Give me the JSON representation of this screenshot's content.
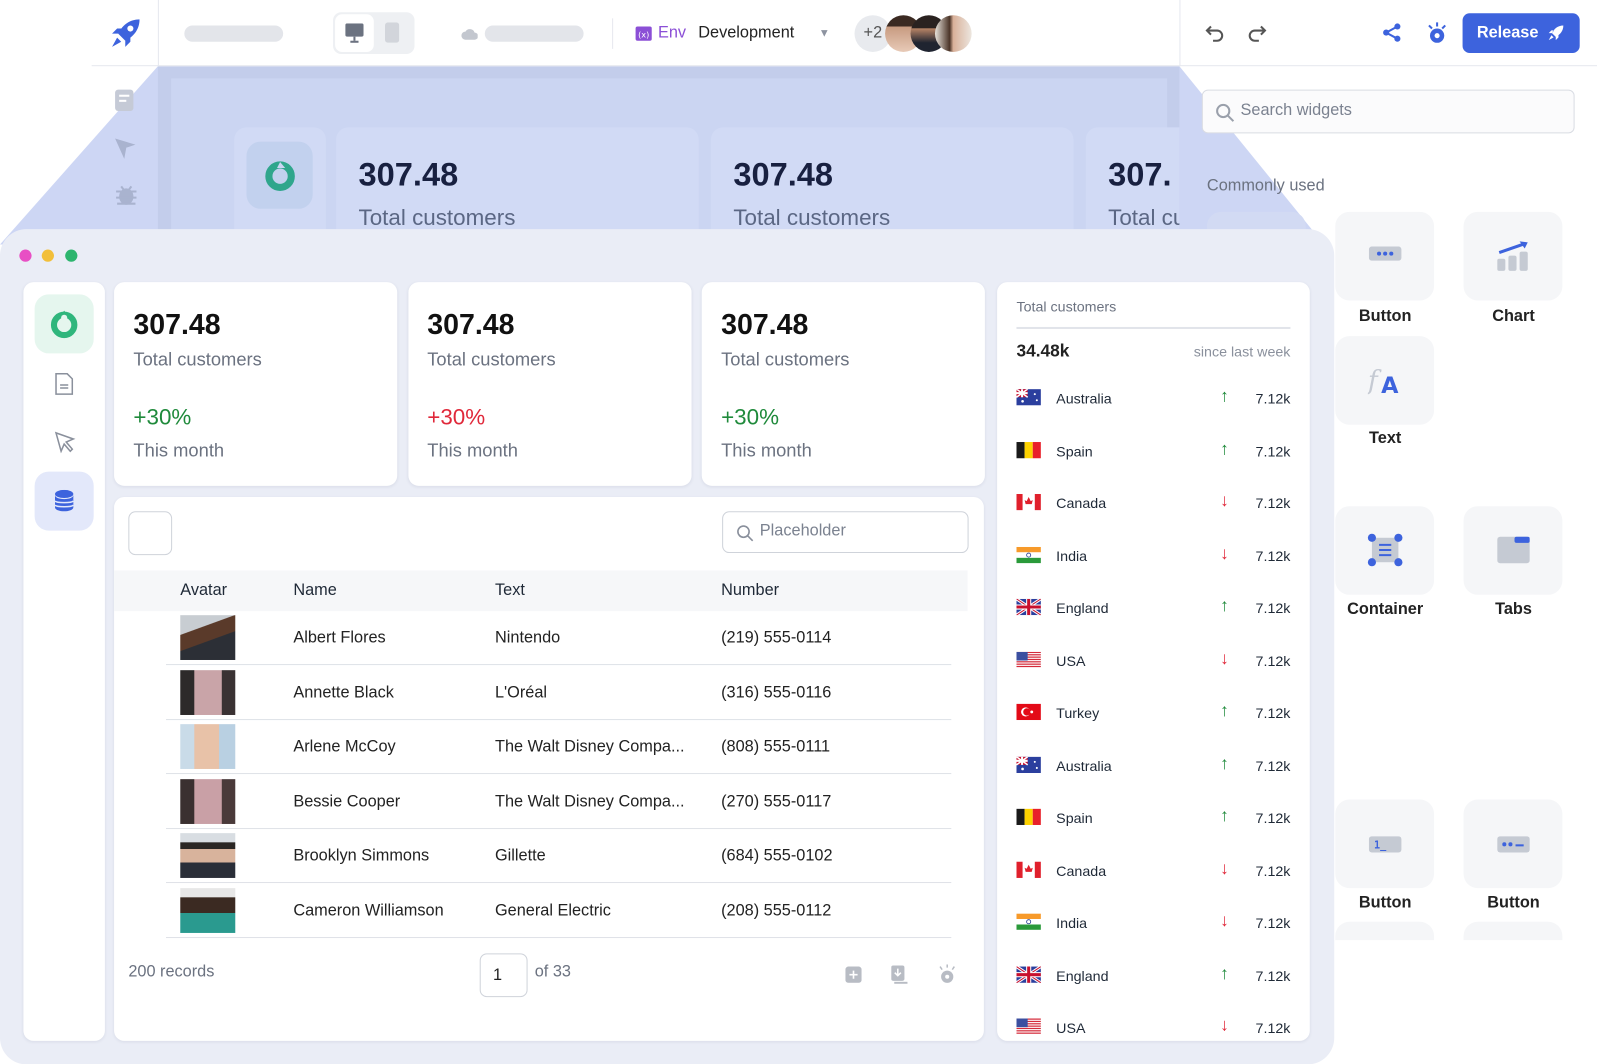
{
  "topbar": {
    "env_label": "Env",
    "env_value": "Development",
    "collaborators_extra": "+2",
    "release_label": "Release",
    "accent": "#3d63dd",
    "env_color": "#8b4fd6"
  },
  "canvas_preview": {
    "cards": [
      {
        "value": "307.48",
        "label": "Total customers"
      },
      {
        "value": "307.48",
        "label": "Total customers"
      },
      {
        "value": "307.",
        "label": "Total cu"
      }
    ]
  },
  "widgets_panel": {
    "search_placeholder": "Search widgets",
    "section_title": "Commonly used",
    "items": [
      {
        "label": "Button",
        "icon": "button-icon"
      },
      {
        "label": "Chart",
        "icon": "chart-icon"
      },
      {
        "label": "Text",
        "icon": "text-icon"
      },
      {
        "label": "Container",
        "icon": "container-icon"
      },
      {
        "label": "Tabs",
        "icon": "tabs-icon"
      },
      {
        "label": "Button",
        "icon": "number-input-icon"
      },
      {
        "label": "Button",
        "icon": "password-input-icon"
      }
    ]
  },
  "app": {
    "stats": [
      {
        "value": "307.48",
        "label": "Total customers",
        "change": "+30%",
        "trend": "up",
        "period": "This month"
      },
      {
        "value": "307.48",
        "label": "Total customers",
        "change": "+30%",
        "trend": "down",
        "period": "This month"
      },
      {
        "value": "307.48",
        "label": "Total customers",
        "change": "+30%",
        "trend": "up",
        "period": "This month"
      }
    ],
    "table": {
      "search_placeholder": "Placeholder",
      "columns": [
        "Avatar",
        "Name",
        "Text",
        "Number"
      ],
      "rows": [
        {
          "name": "Albert Flores",
          "text": "Nintendo",
          "number": "(219) 555-0114"
        },
        {
          "name": "Annette Black",
          "text": "L'Oréal",
          "number": "(316) 555-0116"
        },
        {
          "name": "Arlene McCoy",
          "text": "The Walt Disney Compa...",
          "number": "(808) 555-0111"
        },
        {
          "name": "Bessie Cooper",
          "text": "The Walt Disney Compa...",
          "number": "(270) 555-0117"
        },
        {
          "name": "Brooklyn Simmons",
          "text": "Gillette",
          "number": "(684) 555-0102"
        },
        {
          "name": "Cameron Williamson",
          "text": "General Electric",
          "number": "(208) 555-0112"
        }
      ],
      "records": "200 records",
      "page": "1",
      "of_pages": "of 33"
    },
    "countries": {
      "title": "Total customers",
      "total": "34.48k",
      "since": "since last week",
      "rows": [
        {
          "country": "Australia",
          "flag": "au",
          "trend": "up",
          "value": "7.12k"
        },
        {
          "country": "Spain",
          "flag": "be",
          "trend": "up",
          "value": "7.12k"
        },
        {
          "country": "Canada",
          "flag": "ca",
          "trend": "down",
          "value": "7.12k"
        },
        {
          "country": "India",
          "flag": "in",
          "trend": "down",
          "value": "7.12k"
        },
        {
          "country": "England",
          "flag": "gb",
          "trend": "up",
          "value": "7.12k"
        },
        {
          "country": "USA",
          "flag": "us",
          "trend": "down",
          "value": "7.12k"
        },
        {
          "country": "Turkey",
          "flag": "tr",
          "trend": "up",
          "value": "7.12k"
        },
        {
          "country": "Australia",
          "flag": "au",
          "trend": "up",
          "value": "7.12k"
        },
        {
          "country": "Spain",
          "flag": "be",
          "trend": "up",
          "value": "7.12k"
        },
        {
          "country": "Canada",
          "flag": "ca",
          "trend": "down",
          "value": "7.12k"
        },
        {
          "country": "India",
          "flag": "in",
          "trend": "down",
          "value": "7.12k"
        },
        {
          "country": "England",
          "flag": "gb",
          "trend": "up",
          "value": "7.12k"
        },
        {
          "country": "USA",
          "flag": "us",
          "trend": "down",
          "value": "7.12k"
        }
      ]
    },
    "colors": {
      "up": "#1f8a3b",
      "down": "#e0283a",
      "green_accent": "#2fb67c"
    }
  }
}
